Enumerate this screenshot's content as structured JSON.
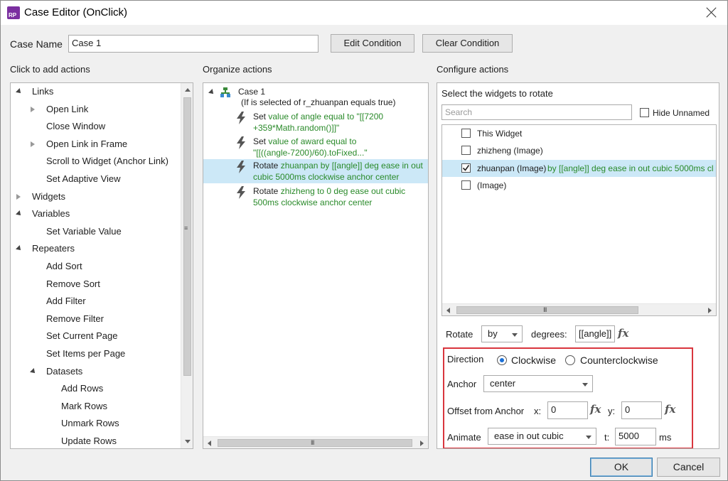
{
  "window": {
    "title": "Case Editor (OnClick)",
    "app_icon_text": "RP"
  },
  "case_name": {
    "label": "Case Name",
    "value": "Case 1"
  },
  "buttons": {
    "edit_condition": "Edit Condition",
    "clear_condition": "Clear Condition",
    "ok": "OK",
    "cancel": "Cancel"
  },
  "sections": {
    "add_actions": "Click to add actions",
    "organize": "Organize actions",
    "configure": "Configure actions"
  },
  "add_actions": [
    {
      "label": "Links",
      "level": 0,
      "expander": "expanded"
    },
    {
      "label": "Open Link",
      "level": 1,
      "expander": "collapsed"
    },
    {
      "label": "Close Window",
      "level": 1,
      "expander": "none"
    },
    {
      "label": "Open Link in Frame",
      "level": 1,
      "expander": "collapsed"
    },
    {
      "label": "Scroll to Widget (Anchor Link)",
      "level": 1,
      "expander": "none"
    },
    {
      "label": "Set Adaptive View",
      "level": 1,
      "expander": "none"
    },
    {
      "label": "Widgets",
      "level": 0,
      "expander": "collapsed"
    },
    {
      "label": "Variables",
      "level": 0,
      "expander": "expanded"
    },
    {
      "label": "Set Variable Value",
      "level": 1,
      "expander": "none"
    },
    {
      "label": "Repeaters",
      "level": 0,
      "expander": "expanded"
    },
    {
      "label": "Add Sort",
      "level": 1,
      "expander": "none"
    },
    {
      "label": "Remove Sort",
      "level": 1,
      "expander": "none"
    },
    {
      "label": "Add Filter",
      "level": 1,
      "expander": "none"
    },
    {
      "label": "Remove Filter",
      "level": 1,
      "expander": "none"
    },
    {
      "label": "Set Current Page",
      "level": 1,
      "expander": "none"
    },
    {
      "label": "Set Items per Page",
      "level": 1,
      "expander": "none"
    },
    {
      "label": "Datasets",
      "level": 1,
      "expander": "expanded"
    },
    {
      "label": "Add Rows",
      "level": 2,
      "expander": "none"
    },
    {
      "label": "Mark Rows",
      "level": 2,
      "expander": "none"
    },
    {
      "label": "Unmark Rows",
      "level": 2,
      "expander": "none"
    },
    {
      "label": "Update Rows",
      "level": 2,
      "expander": "none"
    }
  ],
  "organize": {
    "case_title": "Case 1",
    "condition": "(If is selected of r_zhuanpan equals true)",
    "actions": [
      {
        "verb": "Set",
        "line1": "value of angle equal to \"[[7200",
        "line2": "+359*Math.random()]]\"",
        "selected": false
      },
      {
        "verb": "Set",
        "line1": "value of award equal to",
        "line2": "\"[[((angle-7200)/60).toFixed...\"",
        "selected": false
      },
      {
        "verb": "Rotate",
        "line1": "zhuanpan by [[angle]] deg ease in out",
        "line2": "cubic 5000ms clockwise anchor center",
        "selected": true
      },
      {
        "verb": "Rotate",
        "line1": "zhizheng to 0 deg ease out cubic",
        "line2": "500ms clockwise anchor center",
        "selected": false
      }
    ]
  },
  "configure": {
    "select_label": "Select the widgets to rotate",
    "search_placeholder": "Search",
    "hide_unnamed": "Hide Unnamed",
    "widgets": [
      {
        "name": "This Widget",
        "detail": "",
        "checked": false
      },
      {
        "name": "zhizheng (Image)",
        "detail": "",
        "checked": false
      },
      {
        "name": "zhuanpan (Image)",
        "detail": "by [[angle]] deg ease in out cubic 5000ms cl",
        "checked": true
      },
      {
        "name": "(Image)",
        "detail": "",
        "checked": false
      }
    ],
    "rotate_label": "Rotate",
    "rotate_mode": "by",
    "degrees_label": "degrees:",
    "degrees_value": "[[angle]]",
    "fx": "fx",
    "direction_label": "Direction",
    "clockwise": "Clockwise",
    "counterclockwise": "Counterclockwise",
    "anchor_label": "Anchor",
    "anchor_value": "center",
    "offset_label": "Offset from Anchor",
    "x_label": "x:",
    "x_value": "0",
    "y_label": "y:",
    "y_value": "0",
    "animate_label": "Animate",
    "animate_value": "ease in out cubic",
    "t_label": "t:",
    "t_value": "5000",
    "ms_label": "ms"
  },
  "scroll_grip": "III",
  "vgrip": "≡",
  "colors": {
    "selection": "#cce8f7",
    "highlight_border": "#d9363e",
    "action_text": "#2a8a2a",
    "ok_border": "#3c7fb1"
  }
}
